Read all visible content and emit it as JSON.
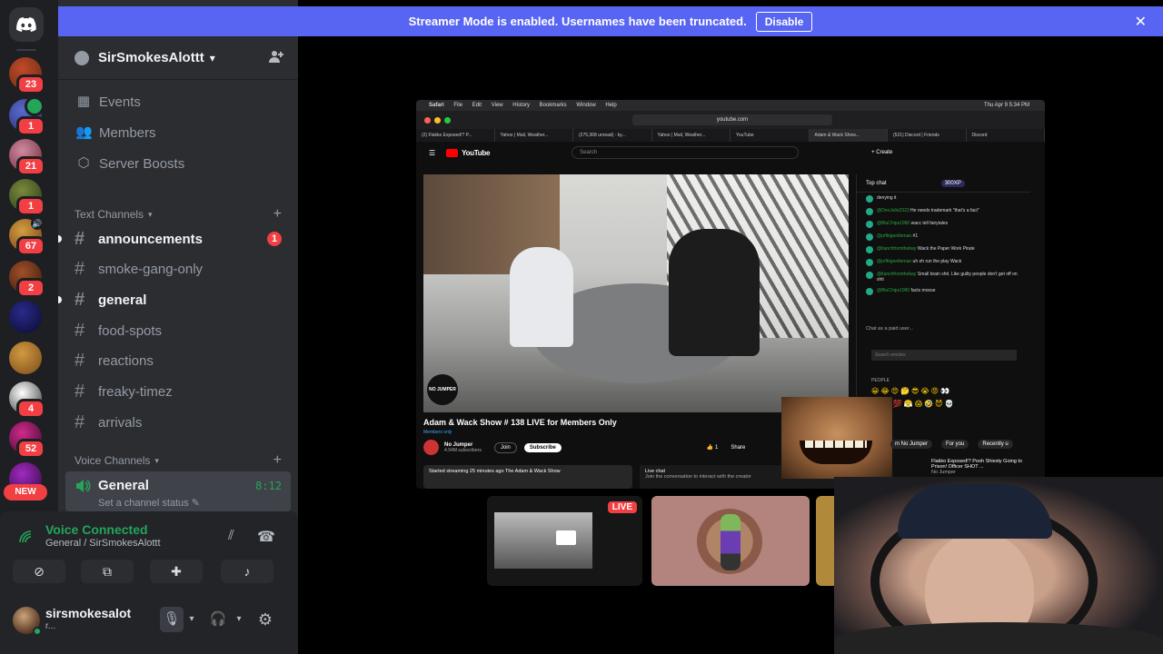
{
  "banner": {
    "text": "Streamer Mode is enabled. Usernames have been truncated.",
    "disable_label": "Disable",
    "close_glyph": "✕"
  },
  "rail": {
    "servers": [
      {
        "count": "23",
        "colors": [
          "#c04a2a",
          "#6a2a10"
        ]
      },
      {
        "count": "1",
        "colors": [
          "#5a6ad0",
          "#2a2f70"
        ],
        "speaker": true
      },
      {
        "count": "21",
        "colors": [
          "#d08aa0",
          "#6a2a3a"
        ]
      },
      {
        "count": "1",
        "colors": [
          "#7a8a3a",
          "#2a3a1a"
        ]
      },
      {
        "count": "67",
        "colors": [
          "#d0a040",
          "#7a3a1a"
        ],
        "volume": true
      },
      {
        "count": "2",
        "colors": [
          "#a0502a",
          "#3a1a0a"
        ]
      },
      {
        "count": "",
        "colors": [
          "#2a2a8a",
          "#0a0a30"
        ]
      },
      {
        "count": "",
        "colors": [
          "#d09a40",
          "#7a4a1a"
        ]
      },
      {
        "count": "4",
        "colors": [
          "#ffffff",
          "#333333"
        ]
      },
      {
        "count": "52",
        "colors": [
          "#d02a8a",
          "#3a0a30"
        ]
      },
      {
        "count": "",
        "colors": [
          "#a02ac0",
          "#300a40"
        ]
      }
    ],
    "new_label": "NEW"
  },
  "server": {
    "name": "SirSmokesAlottt"
  },
  "menu": [
    {
      "label": "Events",
      "icon": "calendar-icon",
      "glyph": "▦"
    },
    {
      "label": "Members",
      "icon": "members-icon",
      "glyph": "👥"
    },
    {
      "label": "Server Boosts",
      "icon": "boost-icon",
      "glyph": "⬡"
    }
  ],
  "text_channels": {
    "category": "Text Channels",
    "items": [
      {
        "name": "announcements",
        "unread": true,
        "badge": "1"
      },
      {
        "name": "smoke-gang-only",
        "unread": false,
        "badge": ""
      },
      {
        "name": "general",
        "unread": true,
        "badge": ""
      },
      {
        "name": "food-spots",
        "unread": false,
        "badge": ""
      },
      {
        "name": "reactions",
        "unread": false,
        "badge": ""
      },
      {
        "name": "freaky-timez",
        "unread": false,
        "badge": ""
      },
      {
        "name": "arrivals",
        "unread": false,
        "badge": ""
      }
    ]
  },
  "voice_channels": {
    "category": "Voice Channels",
    "active": {
      "name": "General",
      "timer": "8:12",
      "status": "Set a channel status"
    }
  },
  "voice_panel": {
    "title": "Voice Connected",
    "subtitle": "General / SirSmokesAlottt"
  },
  "user": {
    "name": "sirsmokesalot",
    "status": "r..."
  },
  "stream": {
    "menubar": [
      "Safari",
      "File",
      "Edit",
      "View",
      "History",
      "Bookmarks",
      "Window",
      "Help"
    ],
    "clock": "Thu Apr 9  5:34 PM",
    "url": "youtube.com",
    "tabs": [
      "(2) Flakko Exposed!? P...",
      "Yahoo | Mail, Weather...",
      "(275,368 unread) - ky...",
      "Yahoo | Mail, Weather...",
      "YouTube",
      "Adam & Wack Show...",
      "(521) Discord | Friends",
      "Discord"
    ],
    "yt": {
      "logo": "YouTube",
      "search": "Search",
      "create": "+ Create"
    },
    "video_title": "Adam & Wack Show # 138 LIVE for Members Only",
    "members_tag": "Members only",
    "channel": "No Jumper",
    "subs": "4.94M subscribers",
    "join": "Join",
    "subscribe": "Subscribe",
    "likes": "1",
    "share": "Share",
    "desc": "Started streaming 25 minutes ago  The Adam & Wack Show",
    "livechat": "Live chat",
    "livechat_sub": "Join the conversation to interact with the creator",
    "chat_top": "Top chat",
    "chat_xp": "300XP",
    "messages": [
      {
        "user": "",
        "text": "denying it"
      },
      {
        "user": "@DonJulio2323",
        "text": "He needs trademark \"that's a fact\""
      },
      {
        "user": "@BluChips1960",
        "text": "wacc tell fairytales"
      },
      {
        "user": "@prfktgentleman",
        "text": "#1"
      },
      {
        "user": "@itanchfromthebay",
        "text": "Wack the Paper Work Pirate"
      },
      {
        "user": "@prfktgentleman",
        "text": "uh oh run the play Wack"
      },
      {
        "user": "@itanchfromthebay",
        "text": "Small brain shit. Like guilty people don't get off on shit"
      },
      {
        "user": "@BluChips1960",
        "text": "facts moose"
      }
    ],
    "chat_input": "Chat as a paid user...",
    "emote_search": "Search emotes",
    "people": "PEOPLE",
    "recs": [
      "m No Jumper",
      "For you",
      "Recently u"
    ],
    "rec_title": "Flakko Exposed!? Pooh Shiesty Going to Prison! Officer SHOT ...",
    "rec_channel": "No Jumper"
  },
  "tiles": {
    "live_label": "LIVE"
  }
}
